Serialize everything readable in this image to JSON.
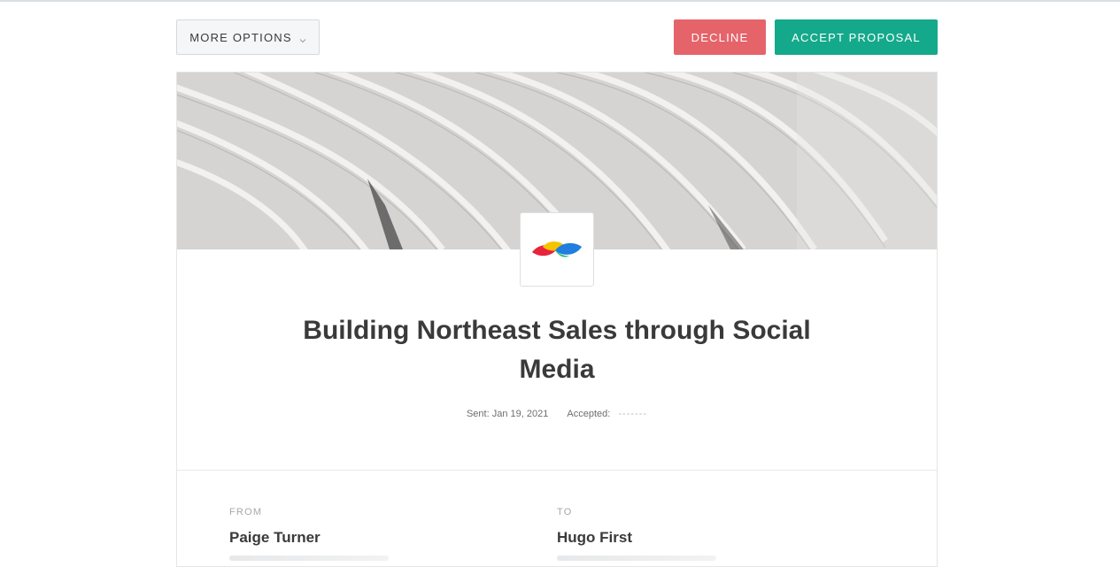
{
  "toolbar": {
    "more_options_label": "MORE OPTIONS",
    "decline_label": "DECLINE",
    "accept_label": "ACCEPT PROPOSAL"
  },
  "colors": {
    "decline": "#e5646a",
    "accept": "#14a98b"
  },
  "proposal": {
    "title": "Building Northeast Sales through Social Media",
    "sent_label": "Sent:",
    "sent_date": "Jan 19, 2021",
    "accepted_label": "Accepted:",
    "accepted_value": "-------"
  },
  "parties": {
    "from_label": "FROM",
    "from_name": "Paige Turner",
    "to_label": "TO",
    "to_name": "Hugo First"
  },
  "icons": {
    "chevron": "chevron-down-icon",
    "logo": "company-logo"
  }
}
